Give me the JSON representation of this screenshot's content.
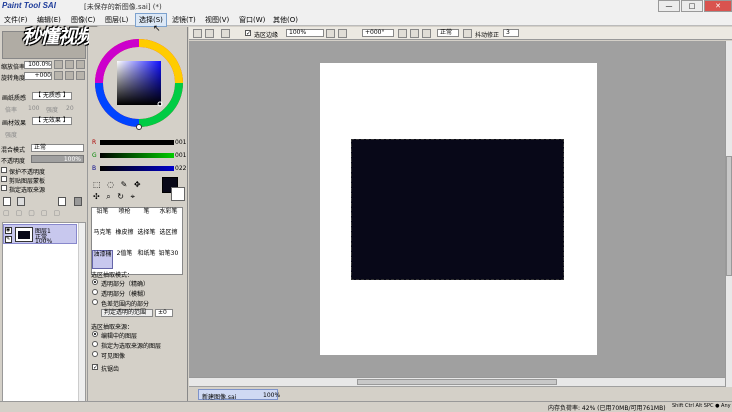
{
  "app": {
    "logo": "Paint Tool SAI",
    "window_title": "[未保存的新图像.sai] (*)"
  },
  "watermark": "秒懂视频",
  "window_buttons": [
    "—",
    "□",
    "✕"
  ],
  "menu": [
    {
      "label": "文件(F)"
    },
    {
      "label": "编辑(E)"
    },
    {
      "label": "图像(C)"
    },
    {
      "label": "图层(L)"
    },
    {
      "label": "选择(S)",
      "selected": true
    },
    {
      "label": "滤镜(T)"
    },
    {
      "label": "视图(V)"
    },
    {
      "label": "窗口(W)"
    },
    {
      "label": "其他(O)"
    }
  ],
  "nav": {
    "zoom_label": "缩放倍率",
    "zoom_value": "100.0%",
    "rotate_label": "旋转角度",
    "rotate_value": "+000"
  },
  "paper": {
    "texture_label": "画纸质感",
    "texture_value": "【 无质感 】",
    "texture_sub1": "倍率",
    "texture_sub2": "强度",
    "texture_v1": "100",
    "texture_v2": "20",
    "effect_label": "画材效果",
    "effect_value": "【 无效果 】",
    "effect_sub": "强度"
  },
  "layer_opts": {
    "mode_label": "混合模式",
    "mode_value": "正常",
    "opacity_label": "不透明度",
    "opacity_value": "100%",
    "chk_protect": "保护不透明度",
    "chk_clip": "剪贴图层蒙板",
    "chk_source": "指定选取来源"
  },
  "layer": {
    "name": "图层1",
    "mode": "正常",
    "opacity": "100%"
  },
  "color": {
    "current": "#080818",
    "r": "001",
    "g": "001",
    "b": "022"
  },
  "tools": [
    [
      "铅笔",
      "喷枪",
      "笔",
      "水彩笔"
    ],
    [
      "马克笔",
      "橡皮擦",
      "选择笔",
      "选区擦"
    ],
    [
      "油漆桶",
      "2值笔",
      "和纸笔",
      "铅笔30"
    ]
  ],
  "select_mode": {
    "title": "选区抽取模式：",
    "options": [
      "透明部分（精确）",
      "透明部分（模糊）",
      "色差范围内的部分"
    ],
    "selected": 0,
    "range_label": "判定透明的范围",
    "range_value": "±0",
    "source_title": "选区抽取来源：",
    "sources": [
      "编辑中的图层",
      "指定为选取来源的图层",
      "可见图像"
    ],
    "source_selected": 0,
    "antialias": "抗锯齿"
  },
  "toolbar": {
    "chk_label": "选区边缘",
    "zoom": "100%",
    "angle": "+000°",
    "blend": "正常",
    "stabilizer_label": "抖动修正",
    "stabilizer_value": "3"
  },
  "document_tab": {
    "name": "新建图像.sai",
    "zoom": "100%"
  },
  "status": {
    "memory": "内存负荷率: 42% (已用70MB/可用761MB)",
    "keys": "Shift Ctrl Alt SPC ● Any"
  }
}
